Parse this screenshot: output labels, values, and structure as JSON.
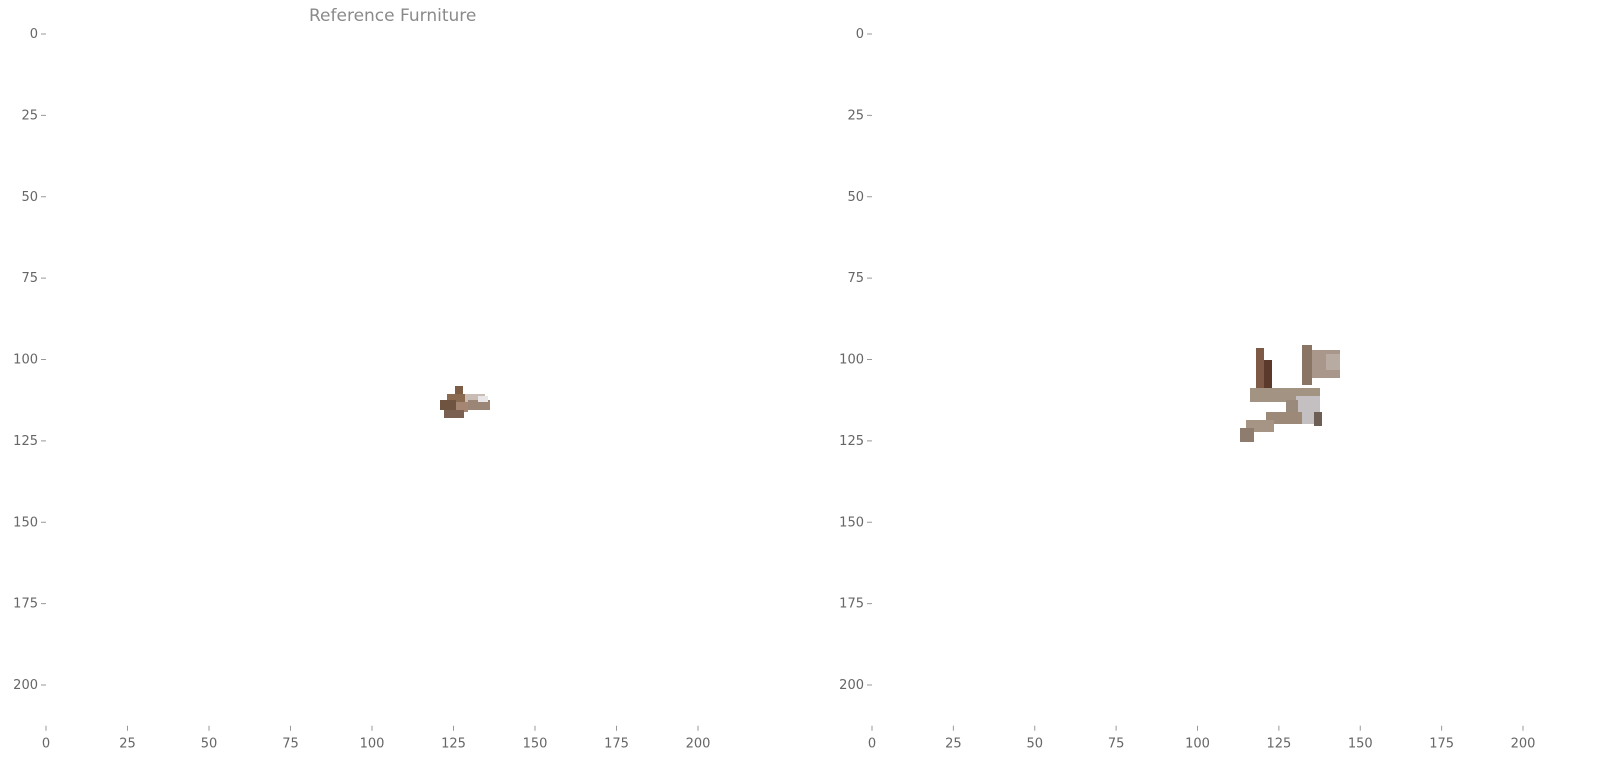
{
  "panels": [
    {
      "title": "Reference Furniture",
      "x_ticks": [
        "0",
        "25",
        "50",
        "75",
        "100",
        "125",
        "150",
        "175",
        "200"
      ],
      "y_ticks": [
        "0",
        "25",
        "50",
        "75",
        "100",
        "125",
        "150",
        "175",
        "200"
      ],
      "image_icon": "furniture-image-icon"
    },
    {
      "title": "",
      "x_ticks": [
        "0",
        "25",
        "50",
        "75",
        "100",
        "125",
        "150",
        "175",
        "200"
      ],
      "y_ticks": [
        "0",
        "25",
        "50",
        "75",
        "100",
        "125",
        "150",
        "175",
        "200"
      ],
      "image_icon": "furniture-image-icon"
    }
  ],
  "colors": {
    "tick": "#999999",
    "label": "#666666",
    "title": "#8a8a8a"
  }
}
